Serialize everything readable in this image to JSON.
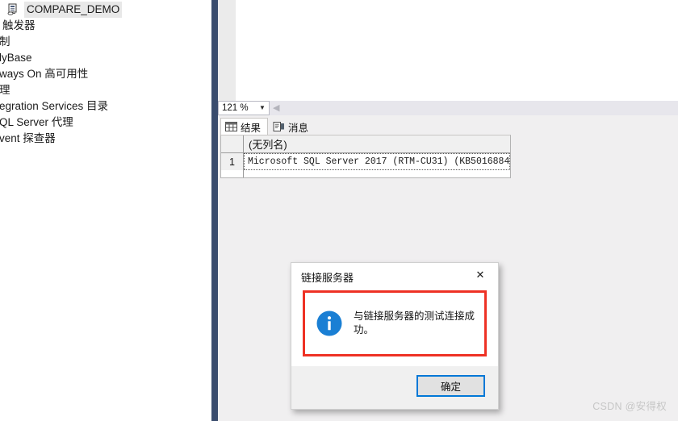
{
  "object_explorer": {
    "nodes": [
      {
        "label": "COMPARE_DEMO",
        "icon": "database-server-icon",
        "selected": true,
        "clipped": false
      },
      {
        "label": "触发器",
        "icon": "",
        "selected": false,
        "clipped": true
      },
      {
        "label": "制",
        "icon": "",
        "selected": false,
        "clipped": true
      },
      {
        "label": "lyBase",
        "icon": "",
        "selected": false,
        "clipped": true
      },
      {
        "label": "ways On 高可用性",
        "icon": "",
        "selected": false,
        "clipped": true
      },
      {
        "label": "理",
        "icon": "",
        "selected": false,
        "clipped": true
      },
      {
        "label": "egration Services 目录",
        "icon": "",
        "selected": false,
        "clipped": true
      },
      {
        "label": "QL Server 代理",
        "icon": "",
        "selected": false,
        "clipped": true
      },
      {
        "label": "vent 探查器",
        "icon": "",
        "selected": false,
        "clipped": true
      }
    ]
  },
  "zoom_bar": {
    "zoom_value": "121 %",
    "chevron": "▼",
    "nav_back": "◀"
  },
  "results": {
    "tabs": [
      {
        "label": "结果",
        "icon": "grid-icon",
        "active": true
      },
      {
        "label": "消息",
        "icon": "messages-icon",
        "active": false
      }
    ],
    "grid": {
      "columns": [
        "(无列名)"
      ],
      "rows": [
        {
          "number": "1",
          "cells": [
            "Microsoft SQL Server 2017 (RTM-CU31) (KB5016884..."
          ]
        }
      ]
    }
  },
  "dialog": {
    "title": "链接服务器",
    "close_label": "✕",
    "icon": "info-icon",
    "message": "与链接服务器的测试连接成功。",
    "ok_label": "确定",
    "highlight_color": "#ee3124",
    "accent_color": "#0078d7",
    "info_color": "#1a7fd4"
  },
  "watermark": {
    "text": "CSDN @安得权"
  }
}
